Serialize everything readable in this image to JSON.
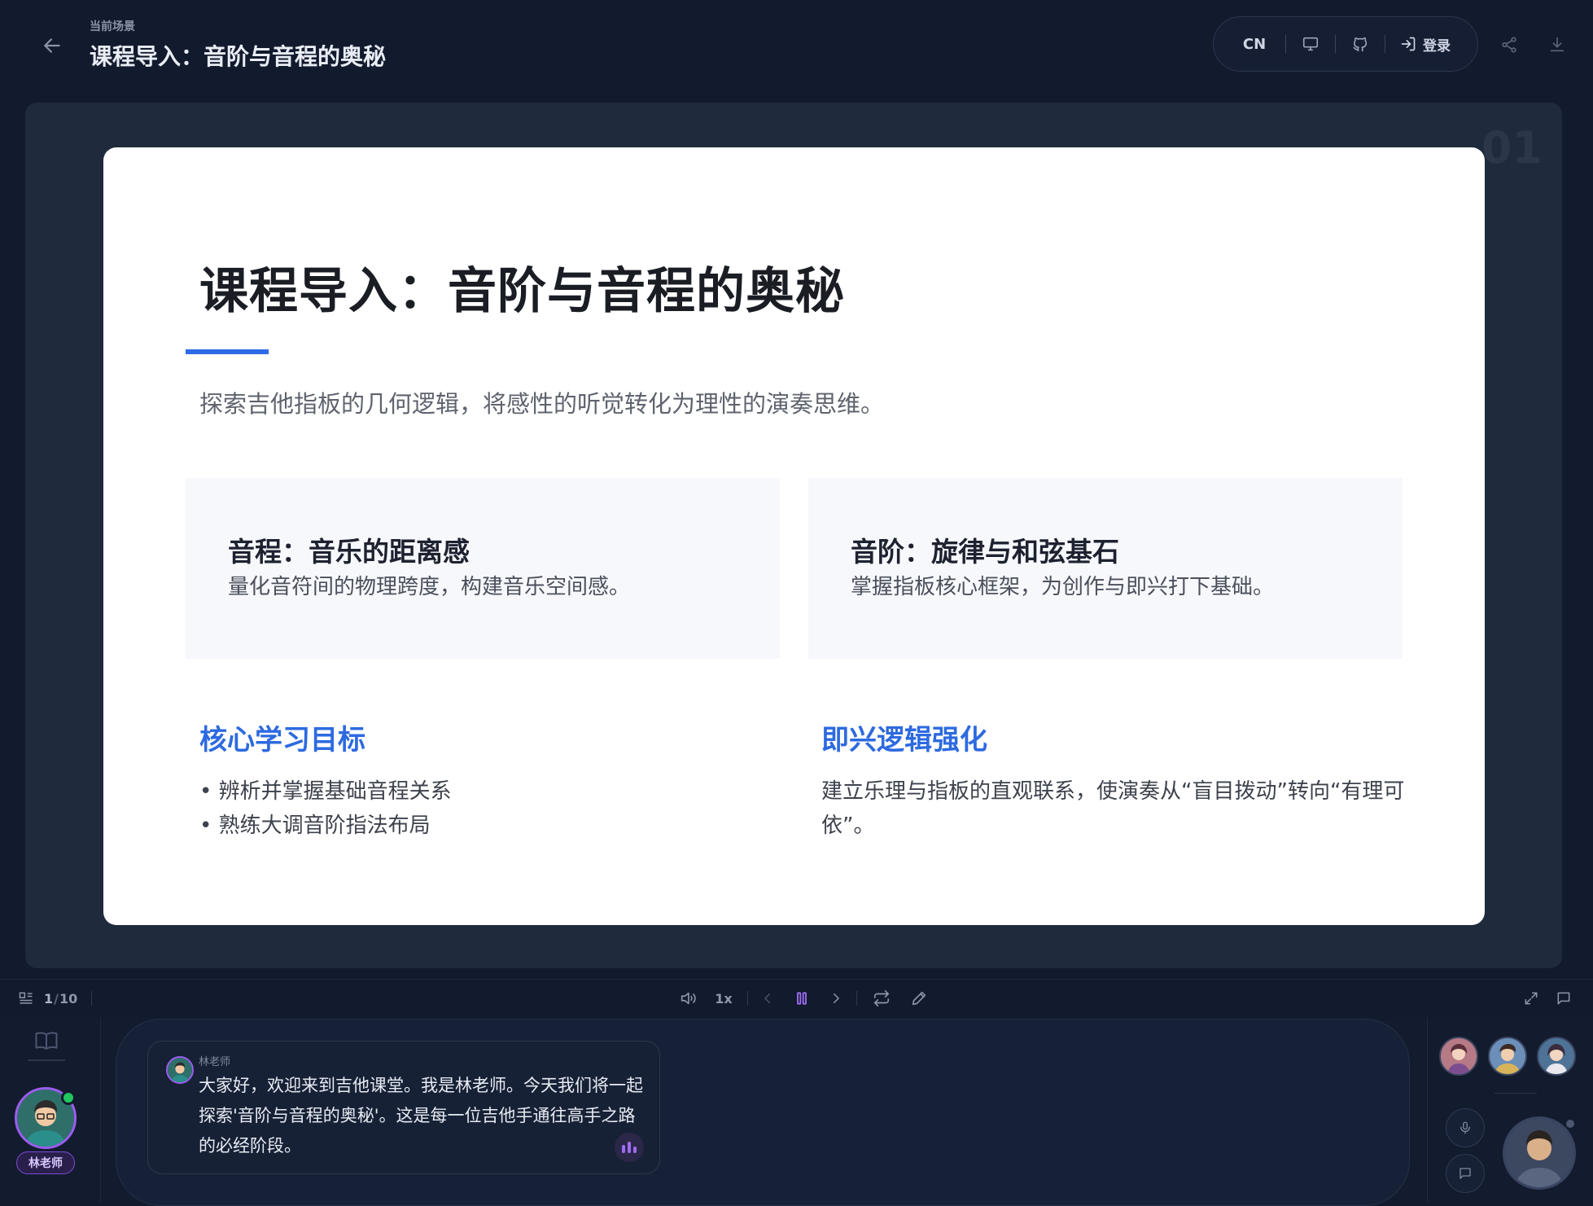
{
  "header": {
    "scene_label": "当前场景",
    "scene_title": "课程导入：音阶与音程的奥秘",
    "lang": "CN",
    "login_label": "登录"
  },
  "slide": {
    "number": "01",
    "title": "课程导入：音阶与音程的奥秘",
    "subtitle": "探索吉他指板的几何逻辑，将感性的听觉转化为理性的演奏思维。",
    "cards": [
      {
        "heading": "音程：音乐的距离感",
        "text": "量化音符间的物理跨度，构建音乐空间感。"
      },
      {
        "heading": "音阶：旋律与和弦基石",
        "text": "掌握指板核心框架，为创作与即兴打下基础。"
      }
    ],
    "goals": {
      "heading": "核心学习目标",
      "items": [
        "• 辨析并掌握基础音程关系",
        "• 熟练大调音阶指法布局"
      ]
    },
    "logic": {
      "heading": "即兴逻辑强化",
      "text": "建立乐理与指板的直观联系，使演奏从“盲目拨动”转向“有理可依”。"
    }
  },
  "controls": {
    "page_current": "1",
    "page_sep": "/",
    "page_total": "10",
    "speed": "1x"
  },
  "chat": {
    "teacher_tag": "林老师",
    "name": "林老师",
    "message": "大家好，欢迎来到吉他课堂。我是林老师。今天我们将一起探索'音阶与音程的奥秘'。这是每一位吉他手通往高手之路的必经阶段。"
  },
  "colors": {
    "accent": "#2f6be6",
    "purple": "#9b5cf0",
    "online": "#22c55e",
    "background": "#121a2d"
  }
}
